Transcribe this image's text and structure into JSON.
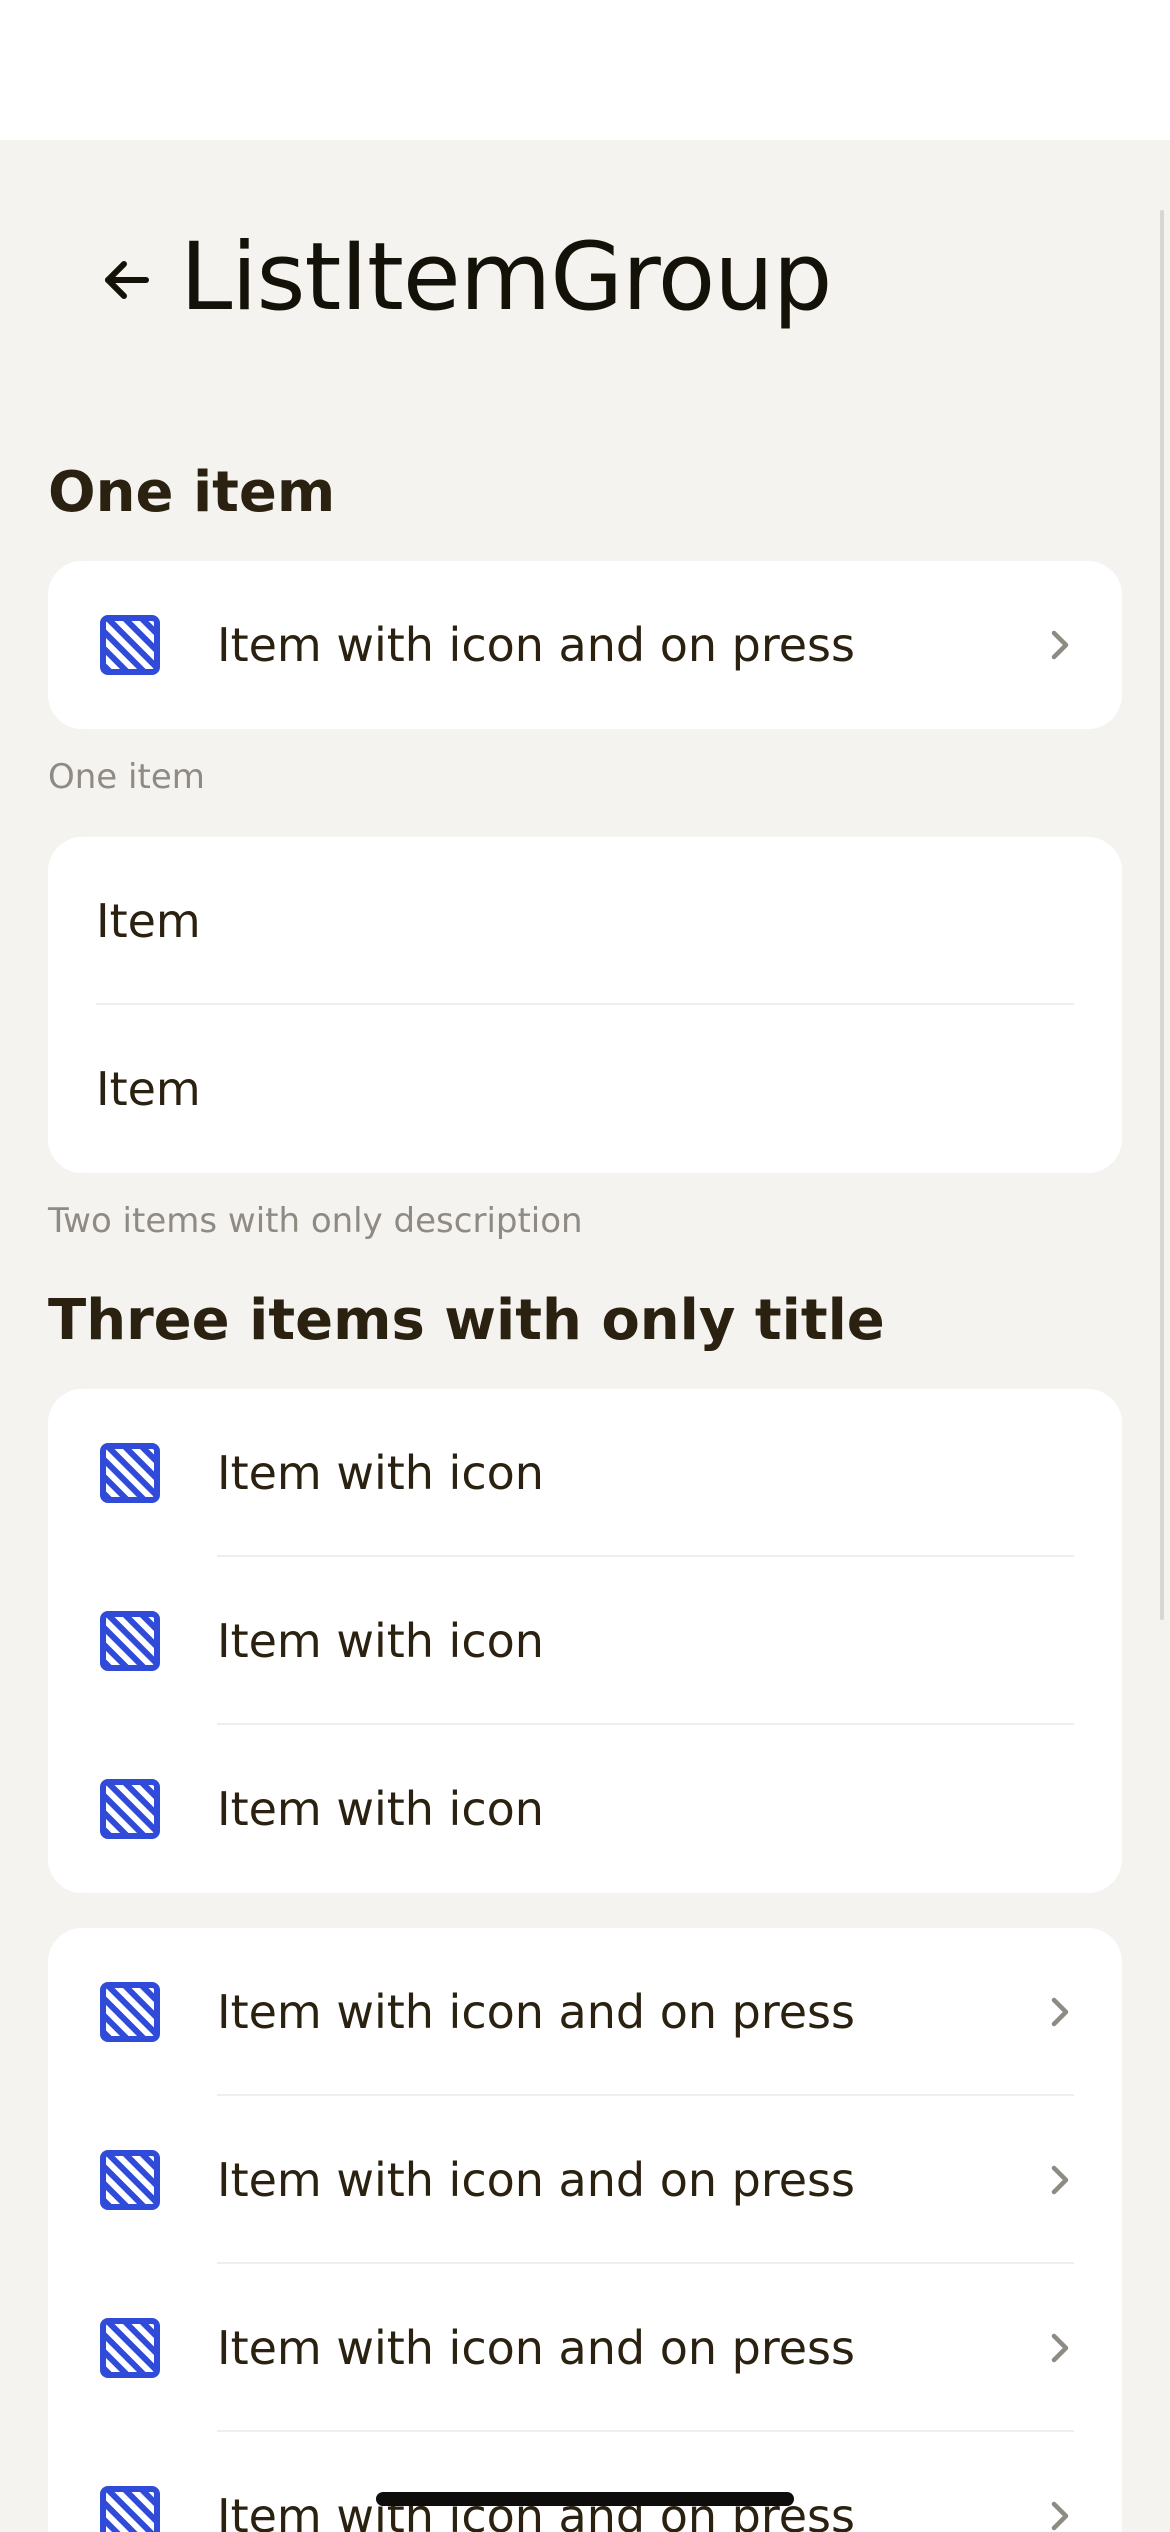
{
  "header": {
    "title": "ListItemGroup",
    "back_icon": "arrow-left-icon"
  },
  "sections": {
    "one_item_title": "One item",
    "one_item_caption": "One item",
    "two_items_caption": "Two items with only description",
    "three_items_title": "Three items with only title"
  },
  "group1": {
    "items": [
      {
        "label": "Item with icon and on press",
        "icon": "placeholder-icon",
        "chevron": true
      }
    ]
  },
  "group2": {
    "items": [
      {
        "label": "Item"
      },
      {
        "label": "Item"
      }
    ]
  },
  "group3": {
    "items": [
      {
        "label": "Item with icon",
        "icon": "placeholder-icon"
      },
      {
        "label": "Item with icon",
        "icon": "placeholder-icon"
      },
      {
        "label": "Item with icon",
        "icon": "placeholder-icon"
      }
    ]
  },
  "group4": {
    "items": [
      {
        "label": "Item with icon and on press",
        "icon": "placeholder-icon",
        "chevron": true
      },
      {
        "label": "Item with icon and on press",
        "icon": "placeholder-icon",
        "chevron": true
      },
      {
        "label": "Item with icon and on press",
        "icon": "placeholder-icon",
        "chevron": true
      },
      {
        "label": "Item with icon and on press",
        "icon": "placeholder-icon",
        "chevron": true
      }
    ]
  },
  "colors": {
    "background": "#f4f3f0",
    "card": "#ffffff",
    "text": "#2a2110",
    "caption": "#8f8b84",
    "icon_blue": "#2f4bd8",
    "chevron": "#8f8b84"
  }
}
